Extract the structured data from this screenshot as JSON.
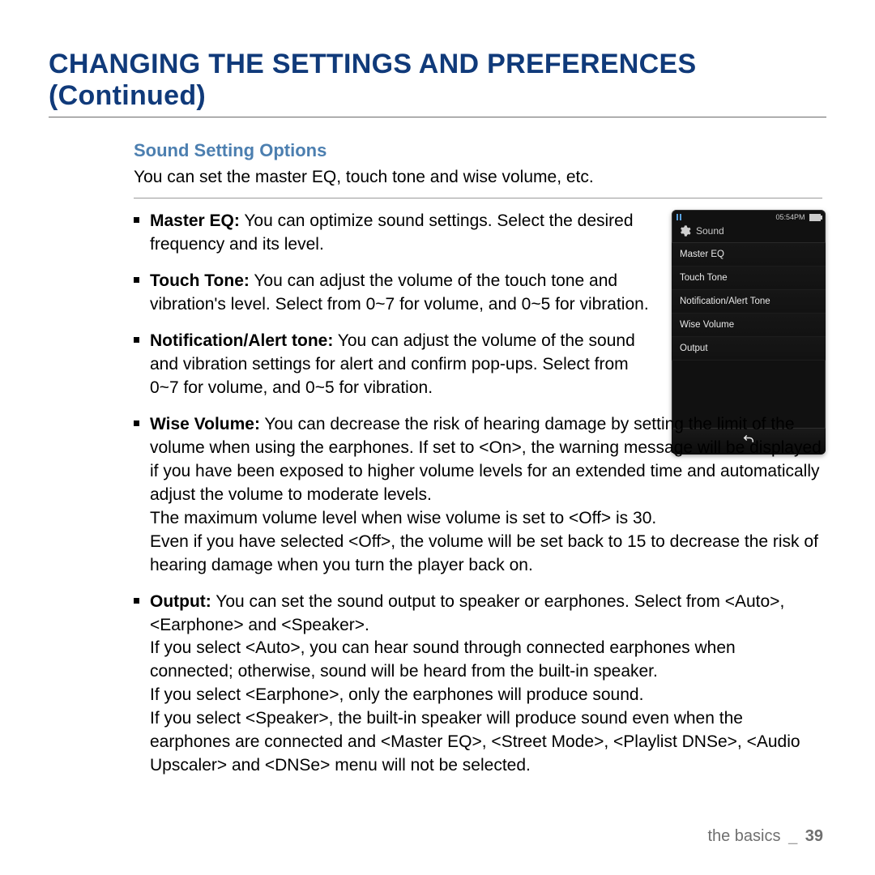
{
  "title": "CHANGING THE SETTINGS AND PREFERENCES (Continued)",
  "subtitle": "Sound Setting Options",
  "intro": "You can set the master EQ, touch tone and wise volume, etc.",
  "bullets": {
    "master_eq": {
      "label": "Master EQ:",
      "text": " You can optimize sound settings. Select the desired frequency and its level."
    },
    "touch_tone": {
      "label": "Touch Tone:",
      "text": " You can adjust the volume of the touch tone and vibration's level. Select from 0~7 for volume, and 0~5 for vibration."
    },
    "notification": {
      "label": "Notification/Alert tone:",
      "text": " You can adjust the volume of the sound and vibration settings for alert and confirm pop-ups. Select from 0~7 for volume, and 0~5 for vibration."
    },
    "wise_volume": {
      "label": "Wise Volume:",
      "text1": " You can decrease the risk of hearing damage by setting the limit of the volume when using the earphones. If set to <On>, the warning message will be displayed if you have been exposed to higher volume levels for an extended time and automatically adjust the volume to moderate levels.",
      "text2": "The maximum volume level when wise volume is set to <Off> is 30.",
      "text3": "Even if you have selected <Off>, the volume will be set back to 15 to decrease the risk of hearing damage when you turn the player back on."
    },
    "output": {
      "label": "Output:",
      "text1": " You can set the sound output to speaker or earphones. Select from <Auto>, <Earphone> and <Speaker>.",
      "text2": "If you select <Auto>, you can hear sound through connected earphones when connected; otherwise, sound will be heard from the built-in speaker.",
      "text3": "If you select <Earphone>, only the earphones will produce sound.",
      "text4": "If you select <Speaker>, the built-in speaker will produce sound even when the earphones are connected and <Master EQ>, <Street Mode>, <Playlist DNSe>, <Audio Upscaler> and <DNSe> menu will not be selected."
    }
  },
  "device": {
    "time": "05:54PM",
    "screen_title": "Sound",
    "menu": [
      "Master EQ",
      "Touch Tone",
      "Notification/Alert Tone",
      "Wise Volume",
      "Output"
    ]
  },
  "footer": {
    "section": "the basics",
    "separator": "_",
    "page": "39"
  }
}
